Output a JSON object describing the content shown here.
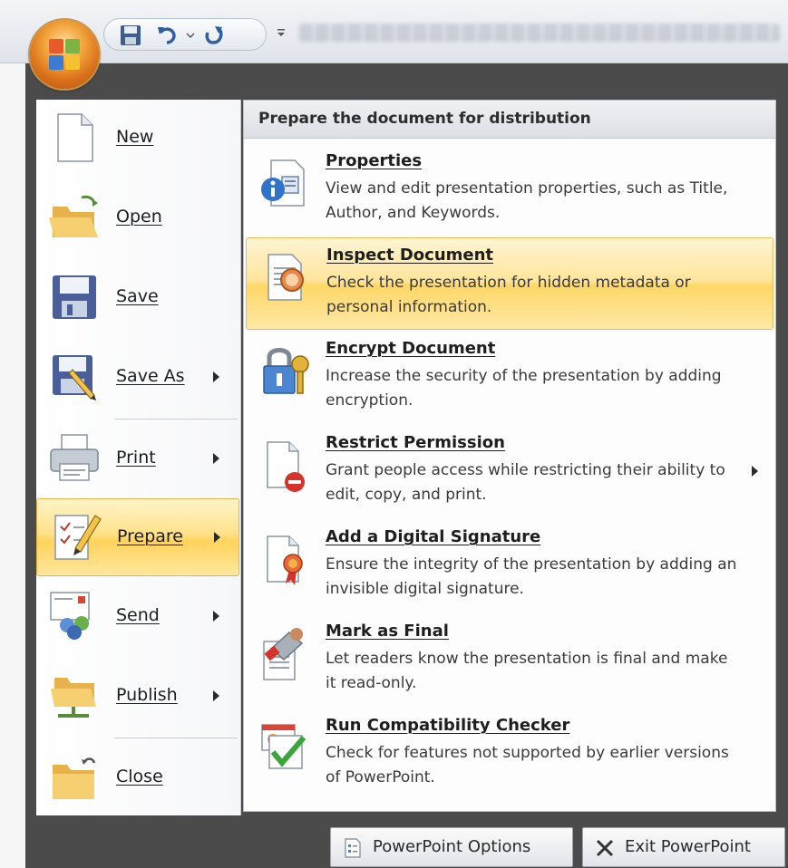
{
  "qat": {
    "buttons": [
      {
        "name": "save",
        "icon": "floppy-disk-icon"
      },
      {
        "name": "undo",
        "icon": "undo-icon"
      },
      {
        "name": "undo-dropdown",
        "icon": "chevron-down-icon"
      },
      {
        "name": "redo",
        "icon": "redo-icon"
      },
      {
        "name": "customize",
        "icon": "customize-qat-icon"
      }
    ]
  },
  "office_button": {
    "icon": "office-logo-icon"
  },
  "left_menu": {
    "items": [
      {
        "label": "New",
        "icon": "new-document-icon",
        "has_submenu": false
      },
      {
        "label": "Open",
        "icon": "open-folder-icon",
        "has_submenu": false
      },
      {
        "label": "Save",
        "icon": "floppy-disk-icon",
        "has_submenu": false
      },
      {
        "label": "Save As",
        "icon": "save-as-icon",
        "has_submenu": true
      },
      {
        "label": "Print",
        "icon": "printer-icon",
        "has_submenu": true
      },
      {
        "label": "Prepare",
        "icon": "prepare-icon",
        "has_submenu": true,
        "active": true
      },
      {
        "label": "Send",
        "icon": "send-icon",
        "has_submenu": true
      },
      {
        "label": "Publish",
        "icon": "publish-icon",
        "has_submenu": true
      },
      {
        "label": "Close",
        "icon": "close-folder-icon",
        "has_submenu": false
      }
    ]
  },
  "submenu": {
    "header": "Prepare the document for distribution",
    "items": [
      {
        "title": "Properties",
        "desc": "View and edit presentation properties, such as Title, Author, and Keywords.",
        "icon": "properties-icon"
      },
      {
        "title": "Inspect Document",
        "desc": "Check the presentation for hidden metadata or personal information.",
        "icon": "inspect-document-icon",
        "active": true
      },
      {
        "title": "Encrypt Document",
        "desc": "Increase the security of the presentation by adding encryption.",
        "icon": "encrypt-lock-icon"
      },
      {
        "title": "Restrict Permission",
        "desc": "Grant people access while restricting their ability to edit, copy, and print.",
        "icon": "restrict-permission-icon",
        "has_submenu": true
      },
      {
        "title": "Add a Digital Signature",
        "desc": "Ensure the integrity of the presentation by adding an invisible digital signature.",
        "icon": "digital-signature-icon"
      },
      {
        "title": "Mark as Final",
        "desc": "Let readers know the presentation is final and make it read-only.",
        "icon": "mark-final-icon"
      },
      {
        "title": "Run Compatibility Checker",
        "desc": "Check for features not supported by earlier versions of PowerPoint.",
        "icon": "compatibility-check-icon"
      }
    ]
  },
  "footer": {
    "options_label": "PowerPoint Options",
    "exit_label": "Exit PowerPoint"
  },
  "colors": {
    "highlight": "#ffd766",
    "frame": "#4b4b4b"
  }
}
